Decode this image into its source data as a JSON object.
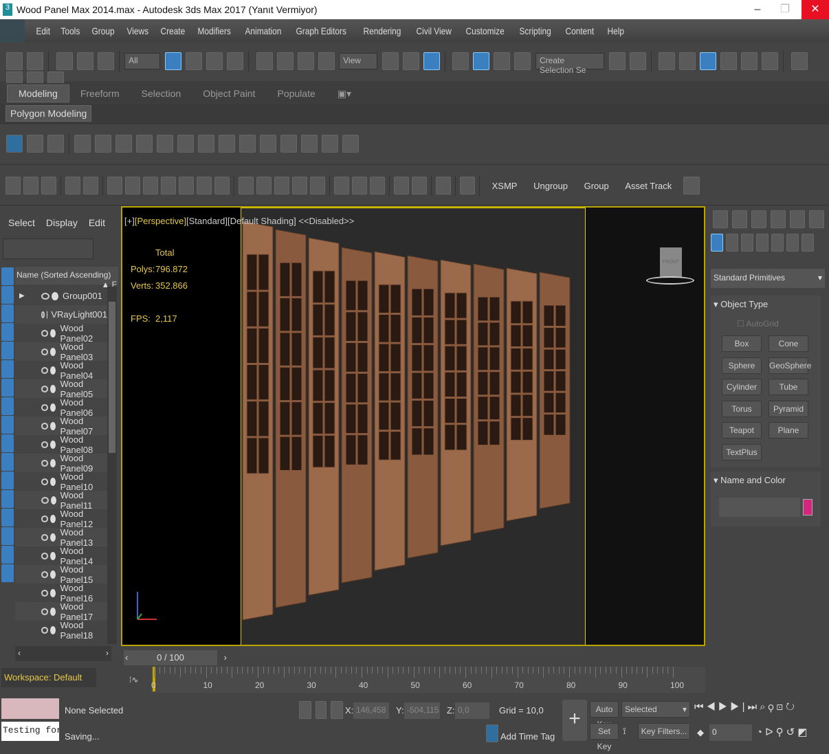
{
  "title": "Wood Panel Max 2014.max - Autodesk 3ds Max 2017  (Yanıt Vermiyor)",
  "app_logo": "3",
  "menu": [
    "Edit",
    "Tools",
    "Group",
    "Views",
    "Create",
    "Modifiers",
    "Animation",
    "Graph Editors",
    "Rendering",
    "Civil View",
    "Customize",
    "Scripting",
    "Content",
    "Help"
  ],
  "toolbar": {
    "filter": "All",
    "refcoord": "View",
    "selection_set": "Create Selection Se"
  },
  "ribbon": {
    "tabs": [
      "Modeling",
      "Freeform",
      "Selection",
      "Object Paint",
      "Populate"
    ],
    "subtab": "Polygon Modeling"
  },
  "toolbar3": {
    "buttons": [
      "XSMP",
      "Ungroup",
      "Group",
      "Asset Track"
    ]
  },
  "explorer": {
    "tabs": [
      "Select",
      "Display",
      "Edit"
    ],
    "column": "Name (Sorted Ascending)",
    "items": [
      "Group001",
      "VRayLight001",
      "Wood Panel02",
      "Wood Panel03",
      "Wood Panel04",
      "Wood Panel05",
      "Wood Panel06",
      "Wood Panel07",
      "Wood Panel08",
      "Wood Panel09",
      "Wood Panel10",
      "Wood Panel11",
      "Wood Panel12",
      "Wood Panel13",
      "Wood Panel14",
      "Wood Panel15",
      "Wood Panel16",
      "Wood Panel17",
      "Wood Panel18"
    ],
    "workspace": "Workspace: Default"
  },
  "viewport": {
    "label_plus": "[+]",
    "label_view": "[Perspective]",
    "label_std": "[Standard]",
    "label_shading": "[Default Shading]",
    "label_disabled": "<<Disabled>>",
    "stats_header": "Total",
    "polys_label": "Polys:",
    "polys": "796.872",
    "verts_label": "Verts:",
    "verts": "352.866",
    "fps_label": "FPS:",
    "fps": "2,117",
    "viewcube": "FRONT"
  },
  "command": {
    "dropdown": "Standard Primitives",
    "object_type": "Object Type",
    "autogrid": "AutoGrid",
    "buttons": [
      "Box",
      "Cone",
      "Sphere",
      "GeoSphere",
      "Cylinder",
      "Tube",
      "Torus",
      "Pyramid",
      "Teapot",
      "Plane",
      "TextPlus"
    ],
    "name_color": "Name and Color",
    "color": "#d4257f"
  },
  "timeline": {
    "frame": "0 / 100",
    "ticks": [
      "0",
      "10",
      "20",
      "30",
      "40",
      "50",
      "60",
      "70",
      "80",
      "90",
      "100"
    ]
  },
  "status": {
    "maxscript": "Testing for i",
    "selected": "None Selected",
    "prompt": "Saving...",
    "x_label": "X:",
    "x": "146,458",
    "y_label": "Y:",
    "y": "-504,115",
    "z_label": "Z:",
    "z": "0,0",
    "grid": "Grid = 10,0",
    "add_time_tag": "Add Time Tag",
    "auto_key": "Auto Key",
    "key_mode": "Selected",
    "set_key": "Set Key",
    "key_filters": "Key Filters...",
    "current_frame": "0"
  }
}
